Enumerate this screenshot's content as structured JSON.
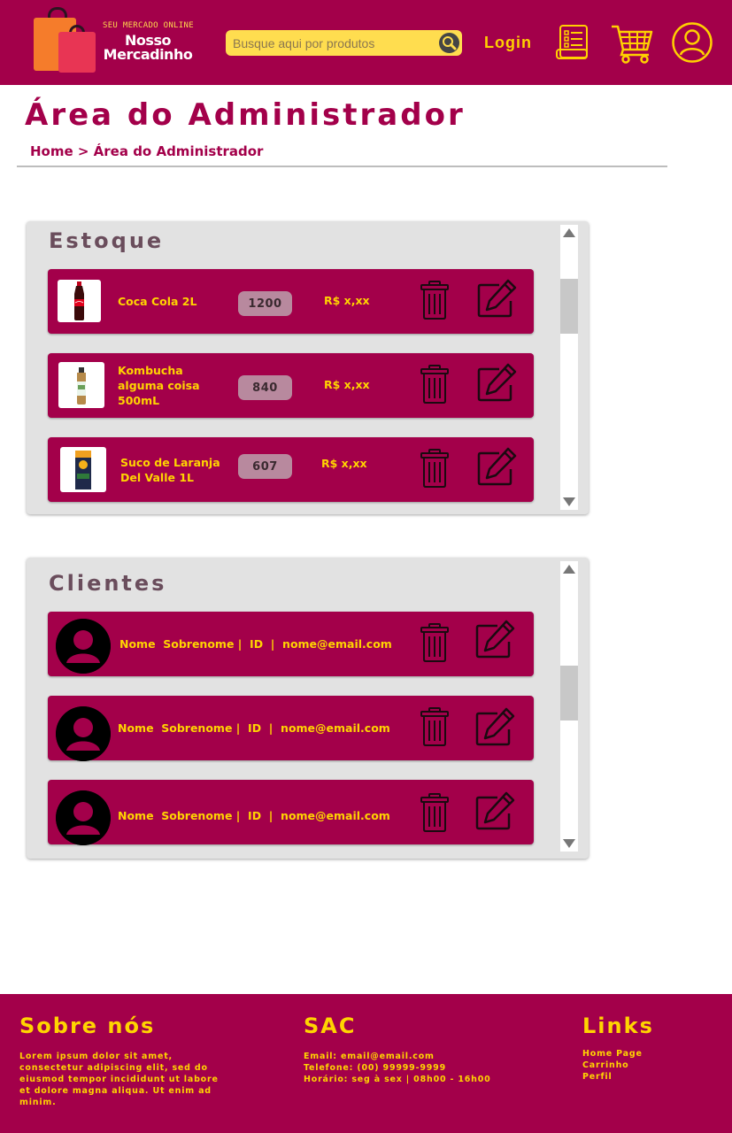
{
  "header": {
    "logo_subtitle": "SEU MERCADO ONLINE",
    "logo_name_line1": "Nosso",
    "logo_name_line2": "Mercadinho",
    "search_placeholder": "Busque aqui por produtos",
    "login_label": "Login",
    "icons": [
      "orders-icon",
      "cart-icon",
      "user-icon",
      "search-icon"
    ]
  },
  "page": {
    "title": "Área do Administrador",
    "breadcrumb": "Home > Área do Administrador"
  },
  "estoque": {
    "title": "Estoque",
    "items": [
      {
        "name": "Coca Cola 2L",
        "quantity": "1200",
        "price": "R$ x,xx",
        "image": "coca-cola-bottle"
      },
      {
        "name": "Kombucha alguma coisa 500mL",
        "quantity": "840",
        "price": "R$ x,xx",
        "image": "kombucha-bottle"
      },
      {
        "name": "Suco de Laranja Del Valle 1L",
        "quantity": "607",
        "price": "R$ x,xx",
        "image": "juice-carton"
      }
    ]
  },
  "clientes": {
    "title": "Clientes",
    "items": [
      {
        "text": "Nome  Sobrenome |  ID  |  nome@email.com"
      },
      {
        "text": "Nome  Sobrenome |  ID  |  nome@email.com"
      },
      {
        "text": "Nome  Sobrenome |  ID  |  nome@email.com"
      }
    ]
  },
  "footer": {
    "about_title": "Sobre nós",
    "about_text": "Lorem ipsum dolor sit amet, consectetur adipiscing elit, sed do eiusmod tempor incididunt ut labore et dolore magna aliqua. Ut enim ad minim.",
    "sac_title": "SAC",
    "sac_email": "Email: email@email.com",
    "sac_phone": "Telefone: (00) 99999-9999",
    "sac_hours": "Horário: seg à sex | 08h00 - 16h00",
    "links_title": "Links",
    "links": [
      "Home Page",
      "Carrinho",
      "Perfil"
    ]
  },
  "colors": {
    "brand": "#a3004a",
    "accent": "#ffd400",
    "panel": "#e2e2e2",
    "quantity_badge": "#b8899e"
  }
}
